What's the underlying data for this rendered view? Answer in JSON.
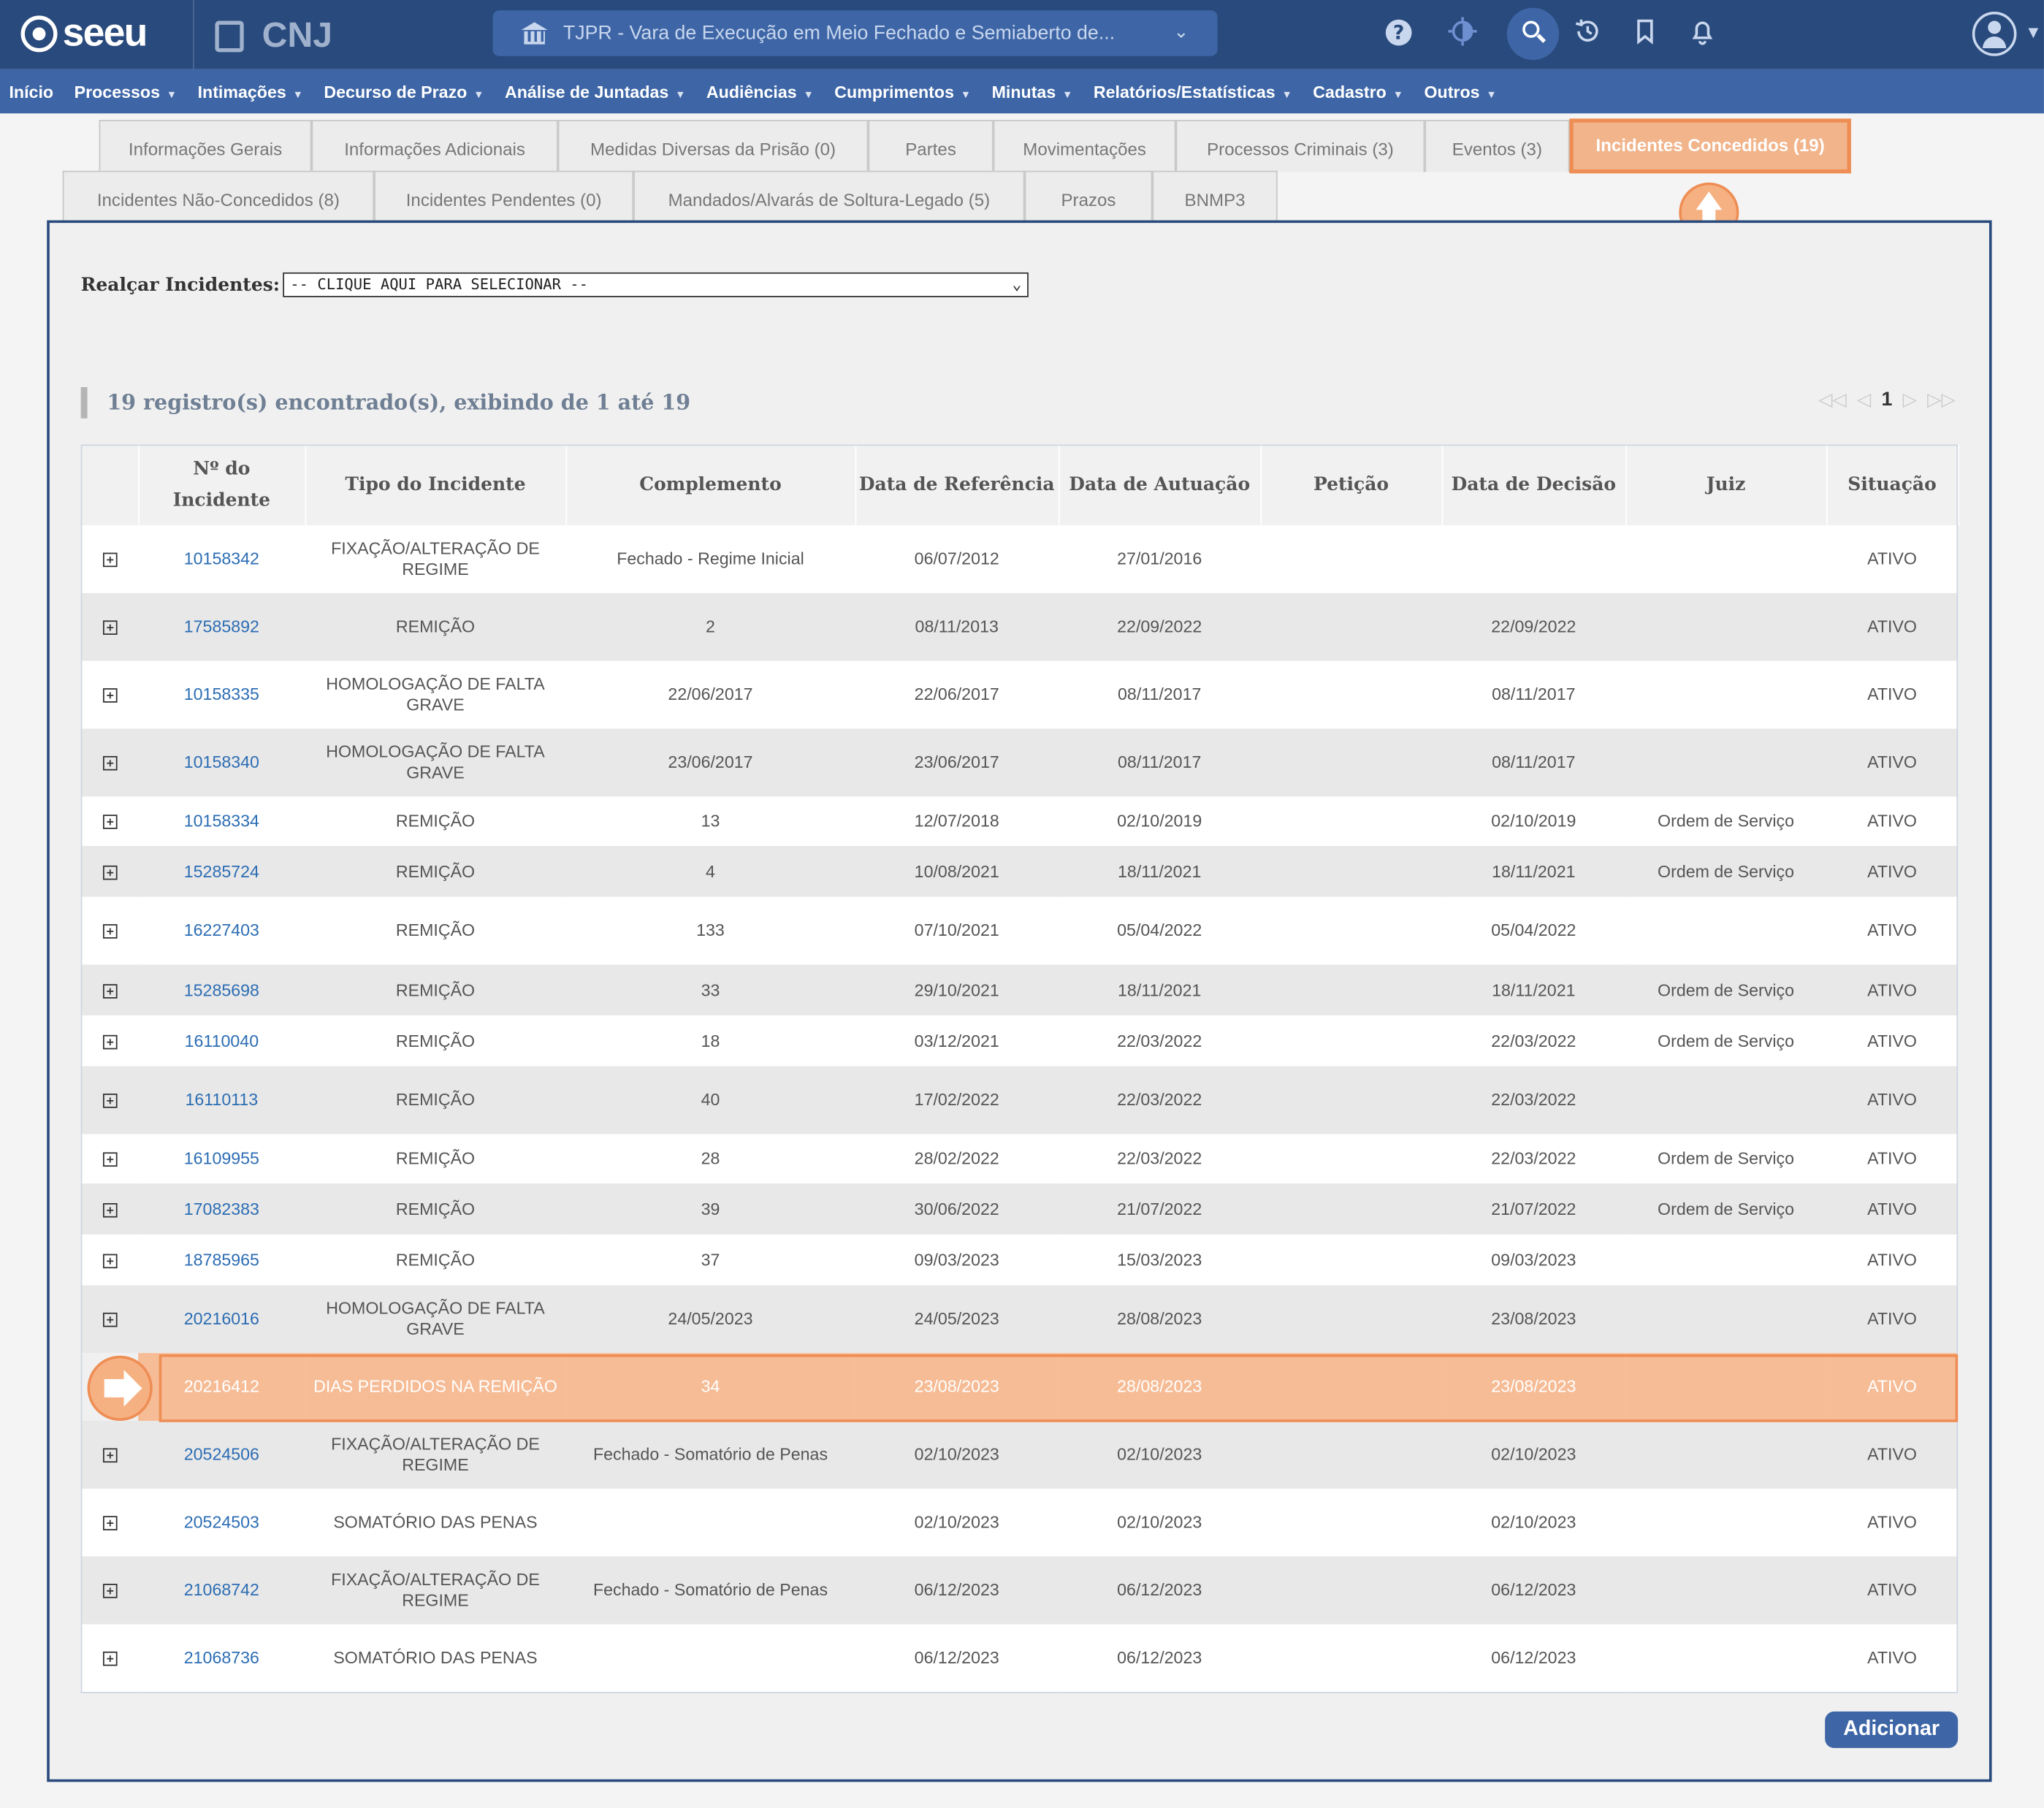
{
  "header": {
    "logo_text": "seeu",
    "cnj_text": "CNJ",
    "court_selector": "TJPR - Vara de Execução em Meio Fechado e Semiaberto de...",
    "help_glyph": "?",
    "icons": [
      "help-icon",
      "contrast-icon",
      "search-icon",
      "history-icon",
      "bookmark-icon",
      "bell-icon",
      "user-avatar-icon"
    ]
  },
  "menu": [
    {
      "label": "Início",
      "has_caret": false
    },
    {
      "label": "Processos",
      "has_caret": true
    },
    {
      "label": "Intimações",
      "has_caret": true
    },
    {
      "label": "Decurso de Prazo",
      "has_caret": true
    },
    {
      "label": "Análise de Juntadas",
      "has_caret": true
    },
    {
      "label": "Audiências",
      "has_caret": true
    },
    {
      "label": "Cumprimentos",
      "has_caret": true
    },
    {
      "label": "Minutas",
      "has_caret": true
    },
    {
      "label": "Relatórios/Estatísticas",
      "has_caret": true
    },
    {
      "label": "Cadastro",
      "has_caret": true
    },
    {
      "label": "Outros",
      "has_caret": true
    }
  ],
  "tabs_row1": [
    "Informações Gerais",
    "Informações Adicionais",
    "Medidas Diversas da Prisão (0)",
    "Partes",
    "Movimentações",
    "Processos Criminais (3)",
    "Eventos (3)",
    "Incidentes Concedidos (19)"
  ],
  "tabs_row2": [
    "Incidentes Não-Concedidos (8)",
    "Incidentes Pendentes (0)",
    "Mandados/Alvarás de Soltura-Legado (5)",
    "Prazos",
    "BNMP3"
  ],
  "active_tab": "Incidentes Concedidos (19)",
  "filter": {
    "label": "Realçar Incidentes:",
    "value": "-- CLIQUE AQUI PARA SELECIONAR --"
  },
  "records_text": "19 registro(s) encontrado(s), exibindo de 1 até 19",
  "pagination": {
    "current_page": "1"
  },
  "table": {
    "headers": [
      "",
      "Nº do Incidente",
      "Tipo do Incidente",
      "Complemento",
      "Data de Referência",
      "Data de Autuação",
      "Petição",
      "Data de Decisão",
      "Juiz",
      "Situação"
    ],
    "rows": [
      {
        "num": "10158342",
        "tipo": "FIXAÇÃO/ALTERAÇÃO DE REGIME",
        "comp": "Fechado - Regime Inicial",
        "ref": "06/07/2012",
        "aut": "27/01/2016",
        "pet": "",
        "dec": "",
        "juiz": "",
        "sit": "ATIVO"
      },
      {
        "num": "17585892",
        "tipo": "REMIÇÃO",
        "comp": "2",
        "ref": "08/11/2013",
        "aut": "22/09/2022",
        "pet": "",
        "dec": "22/09/2022",
        "juiz": "",
        "sit": "ATIVO"
      },
      {
        "num": "10158335",
        "tipo": "HOMOLOGAÇÃO DE FALTA GRAVE",
        "comp": "22/06/2017",
        "ref": "22/06/2017",
        "aut": "08/11/2017",
        "pet": "",
        "dec": "08/11/2017",
        "juiz": "",
        "sit": "ATIVO"
      },
      {
        "num": "10158340",
        "tipo": "HOMOLOGAÇÃO DE FALTA GRAVE",
        "comp": "23/06/2017",
        "ref": "23/06/2017",
        "aut": "08/11/2017",
        "pet": "",
        "dec": "08/11/2017",
        "juiz": "",
        "sit": "ATIVO"
      },
      {
        "num": "10158334",
        "tipo": "REMIÇÃO",
        "comp": "13",
        "ref": "12/07/2018",
        "aut": "02/10/2019",
        "pet": "",
        "dec": "02/10/2019",
        "juiz": "Ordem de Serviço",
        "sit": "ATIVO"
      },
      {
        "num": "15285724",
        "tipo": "REMIÇÃO",
        "comp": "4",
        "ref": "10/08/2021",
        "aut": "18/11/2021",
        "pet": "",
        "dec": "18/11/2021",
        "juiz": "Ordem de Serviço",
        "sit": "ATIVO"
      },
      {
        "num": "16227403",
        "tipo": "REMIÇÃO",
        "comp": "133",
        "ref": "07/10/2021",
        "aut": "05/04/2022",
        "pet": "",
        "dec": "05/04/2022",
        "juiz": "",
        "sit": "ATIVO"
      },
      {
        "num": "15285698",
        "tipo": "REMIÇÃO",
        "comp": "33",
        "ref": "29/10/2021",
        "aut": "18/11/2021",
        "pet": "",
        "dec": "18/11/2021",
        "juiz": "Ordem de Serviço",
        "sit": "ATIVO"
      },
      {
        "num": "16110040",
        "tipo": "REMIÇÃO",
        "comp": "18",
        "ref": "03/12/2021",
        "aut": "22/03/2022",
        "pet": "",
        "dec": "22/03/2022",
        "juiz": "Ordem de Serviço",
        "sit": "ATIVO"
      },
      {
        "num": "16110113",
        "tipo": "REMIÇÃO",
        "comp": "40",
        "ref": "17/02/2022",
        "aut": "22/03/2022",
        "pet": "",
        "dec": "22/03/2022",
        "juiz": "",
        "sit": "ATIVO"
      },
      {
        "num": "16109955",
        "tipo": "REMIÇÃO",
        "comp": "28",
        "ref": "28/02/2022",
        "aut": "22/03/2022",
        "pet": "",
        "dec": "22/03/2022",
        "juiz": "Ordem de Serviço",
        "sit": "ATIVO"
      },
      {
        "num": "17082383",
        "tipo": "REMIÇÃO",
        "comp": "39",
        "ref": "30/06/2022",
        "aut": "21/07/2022",
        "pet": "",
        "dec": "21/07/2022",
        "juiz": "Ordem de Serviço",
        "sit": "ATIVO"
      },
      {
        "num": "18785965",
        "tipo": "REMIÇÃO",
        "comp": "37",
        "ref": "09/03/2023",
        "aut": "15/03/2023",
        "pet": "",
        "dec": "09/03/2023",
        "juiz": "",
        "sit": "ATIVO"
      },
      {
        "num": "20216016",
        "tipo": "HOMOLOGAÇÃO DE FALTA GRAVE",
        "comp": "24/05/2023",
        "ref": "24/05/2023",
        "aut": "28/08/2023",
        "pet": "",
        "dec": "23/08/2023",
        "juiz": "",
        "sit": "ATIVO"
      },
      {
        "num": "20216412",
        "tipo": "DIAS PERDIDOS NA REMIÇÃO",
        "comp": "34",
        "ref": "23/08/2023",
        "aut": "28/08/2023",
        "pet": "",
        "dec": "23/08/2023",
        "juiz": "",
        "sit": "ATIVO",
        "highlighted": true
      },
      {
        "num": "20524506",
        "tipo": "FIXAÇÃO/ALTERAÇÃO DE REGIME",
        "comp": "Fechado - Somatório de Penas",
        "ref": "02/10/2023",
        "aut": "02/10/2023",
        "pet": "",
        "dec": "02/10/2023",
        "juiz": "",
        "sit": "ATIVO"
      },
      {
        "num": "20524503",
        "tipo": "SOMATÓRIO DAS PENAS",
        "comp": "",
        "ref": "02/10/2023",
        "aut": "02/10/2023",
        "pet": "",
        "dec": "02/10/2023",
        "juiz": "",
        "sit": "ATIVO"
      },
      {
        "num": "21068742",
        "tipo": "FIXAÇÃO/ALTERAÇÃO DE REGIME",
        "comp": "Fechado - Somatório de Penas",
        "ref": "06/12/2023",
        "aut": "06/12/2023",
        "pet": "",
        "dec": "06/12/2023",
        "juiz": "",
        "sit": "ATIVO"
      },
      {
        "num": "21068736",
        "tipo": "SOMATÓRIO DAS PENAS",
        "comp": "",
        "ref": "06/12/2023",
        "aut": "06/12/2023",
        "pet": "",
        "dec": "06/12/2023",
        "juiz": "",
        "sit": "ATIVO"
      }
    ]
  },
  "add_button": "Adicionar",
  "colors": {
    "topbar": "#294a7c",
    "menubar": "#3e66a6",
    "highlight_fill": "#f6bc96",
    "highlight_border": "#ee8d54",
    "link": "#2c6db4"
  }
}
